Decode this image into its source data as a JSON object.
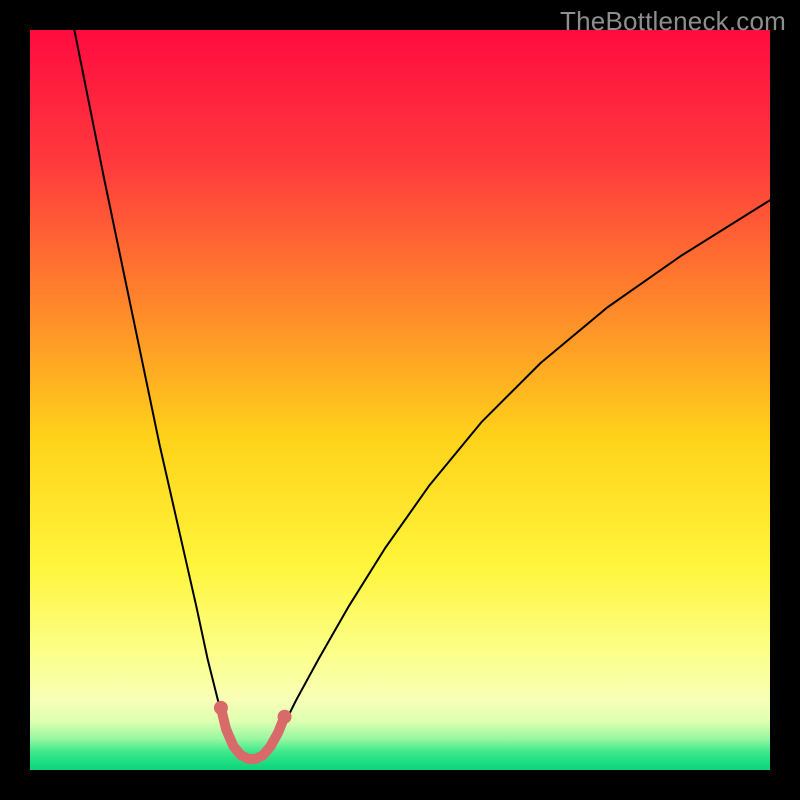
{
  "watermark": "TheBottleneck.com",
  "chart_data": {
    "type": "line",
    "title": "",
    "xlabel": "",
    "ylabel": "",
    "xlim": [
      0,
      100
    ],
    "ylim": [
      0,
      100
    ],
    "grid": false,
    "legend": false,
    "background_gradient_stops": [
      {
        "pos": 0.0,
        "color": "#ff0b3f"
      },
      {
        "pos": 0.18,
        "color": "#ff3a3d"
      },
      {
        "pos": 0.38,
        "color": "#ff8a2a"
      },
      {
        "pos": 0.55,
        "color": "#ffd21a"
      },
      {
        "pos": 0.72,
        "color": "#fff53a"
      },
      {
        "pos": 0.84,
        "color": "#fcff88"
      },
      {
        "pos": 0.905,
        "color": "#f8ffb7"
      },
      {
        "pos": 0.935,
        "color": "#dcffb0"
      },
      {
        "pos": 0.958,
        "color": "#96f7a0"
      },
      {
        "pos": 0.975,
        "color": "#3fe88c"
      },
      {
        "pos": 0.992,
        "color": "#18db80"
      },
      {
        "pos": 1.0,
        "color": "#0fd37a"
      }
    ],
    "series": [
      {
        "name": "bottleneck-curve",
        "stroke": "#000000",
        "stroke_width": 2,
        "points": [
          {
            "x": 6.0,
            "y": 100.0
          },
          {
            "x": 8.0,
            "y": 90.0
          },
          {
            "x": 10.0,
            "y": 80.0
          },
          {
            "x": 12.5,
            "y": 68.0
          },
          {
            "x": 15.0,
            "y": 56.0
          },
          {
            "x": 17.5,
            "y": 44.0
          },
          {
            "x": 20.0,
            "y": 33.0
          },
          {
            "x": 22.5,
            "y": 22.0
          },
          {
            "x": 24.0,
            "y": 15.0
          },
          {
            "x": 25.5,
            "y": 9.0
          },
          {
            "x": 26.5,
            "y": 5.5
          },
          {
            "x": 27.5,
            "y": 3.2
          },
          {
            "x": 28.5,
            "y": 2.0
          },
          {
            "x": 29.5,
            "y": 1.5
          },
          {
            "x": 30.5,
            "y": 1.5
          },
          {
            "x": 31.5,
            "y": 2.0
          },
          {
            "x": 32.5,
            "y": 3.2
          },
          {
            "x": 34.0,
            "y": 5.5
          },
          {
            "x": 36.0,
            "y": 9.5
          },
          {
            "x": 39.0,
            "y": 15.0
          },
          {
            "x": 43.0,
            "y": 22.0
          },
          {
            "x": 48.0,
            "y": 30.0
          },
          {
            "x": 54.0,
            "y": 38.5
          },
          {
            "x": 61.0,
            "y": 47.0
          },
          {
            "x": 69.0,
            "y": 55.0
          },
          {
            "x": 78.0,
            "y": 62.5
          },
          {
            "x": 88.0,
            "y": 69.5
          },
          {
            "x": 100.0,
            "y": 77.0
          }
        ]
      },
      {
        "name": "bottom-highlight",
        "stroke": "#d86a6a",
        "stroke_width": 10,
        "points": [
          {
            "x": 25.8,
            "y": 8.4
          },
          {
            "x": 26.5,
            "y": 5.5
          },
          {
            "x": 27.5,
            "y": 3.2
          },
          {
            "x": 28.5,
            "y": 2.0
          },
          {
            "x": 29.5,
            "y": 1.5
          },
          {
            "x": 30.5,
            "y": 1.5
          },
          {
            "x": 31.5,
            "y": 2.0
          },
          {
            "x": 32.5,
            "y": 3.2
          },
          {
            "x": 33.5,
            "y": 5.0
          },
          {
            "x": 34.4,
            "y": 7.2
          }
        ],
        "endpoint_markers": [
          {
            "x": 25.8,
            "y": 8.4,
            "r": 7
          },
          {
            "x": 34.4,
            "y": 7.2,
            "r": 7
          }
        ]
      }
    ]
  }
}
